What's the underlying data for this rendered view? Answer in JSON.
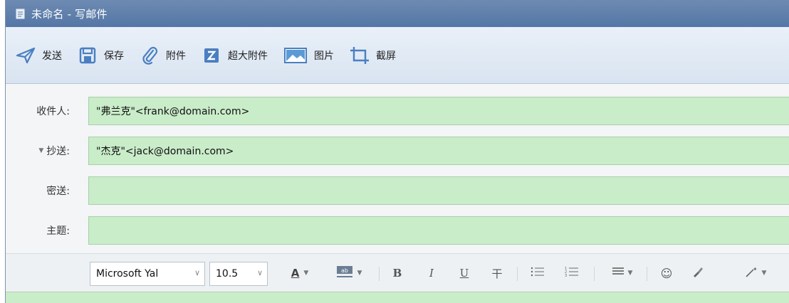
{
  "window": {
    "title": "未命名 - 写邮件"
  },
  "toolbar": {
    "send": "发送",
    "save": "保存",
    "attach": "附件",
    "large_attach": "超大附件",
    "picture": "图片",
    "screenshot": "截屏"
  },
  "fields": {
    "to_label": "收件人:",
    "to_value": "\"弗兰克\"<frank@domain.com>",
    "cc_label": "抄送:",
    "cc_value": "\"杰克\"<jack@domain.com>",
    "bcc_label": "密送:",
    "bcc_value": "",
    "subject_label": "主题:",
    "subject_value": ""
  },
  "format_bar": {
    "font_family": "Microsoft Yal",
    "font_size": "10.5",
    "font_color_glyph": "A",
    "bold_glyph": "B",
    "italic_glyph": "I",
    "underline_glyph": "U",
    "strike_glyph": "干"
  },
  "colors": {
    "title_bar": "#5a7cab",
    "field_fill": "#c9ecc9",
    "toolbar_icon": "#4a7fc1"
  }
}
